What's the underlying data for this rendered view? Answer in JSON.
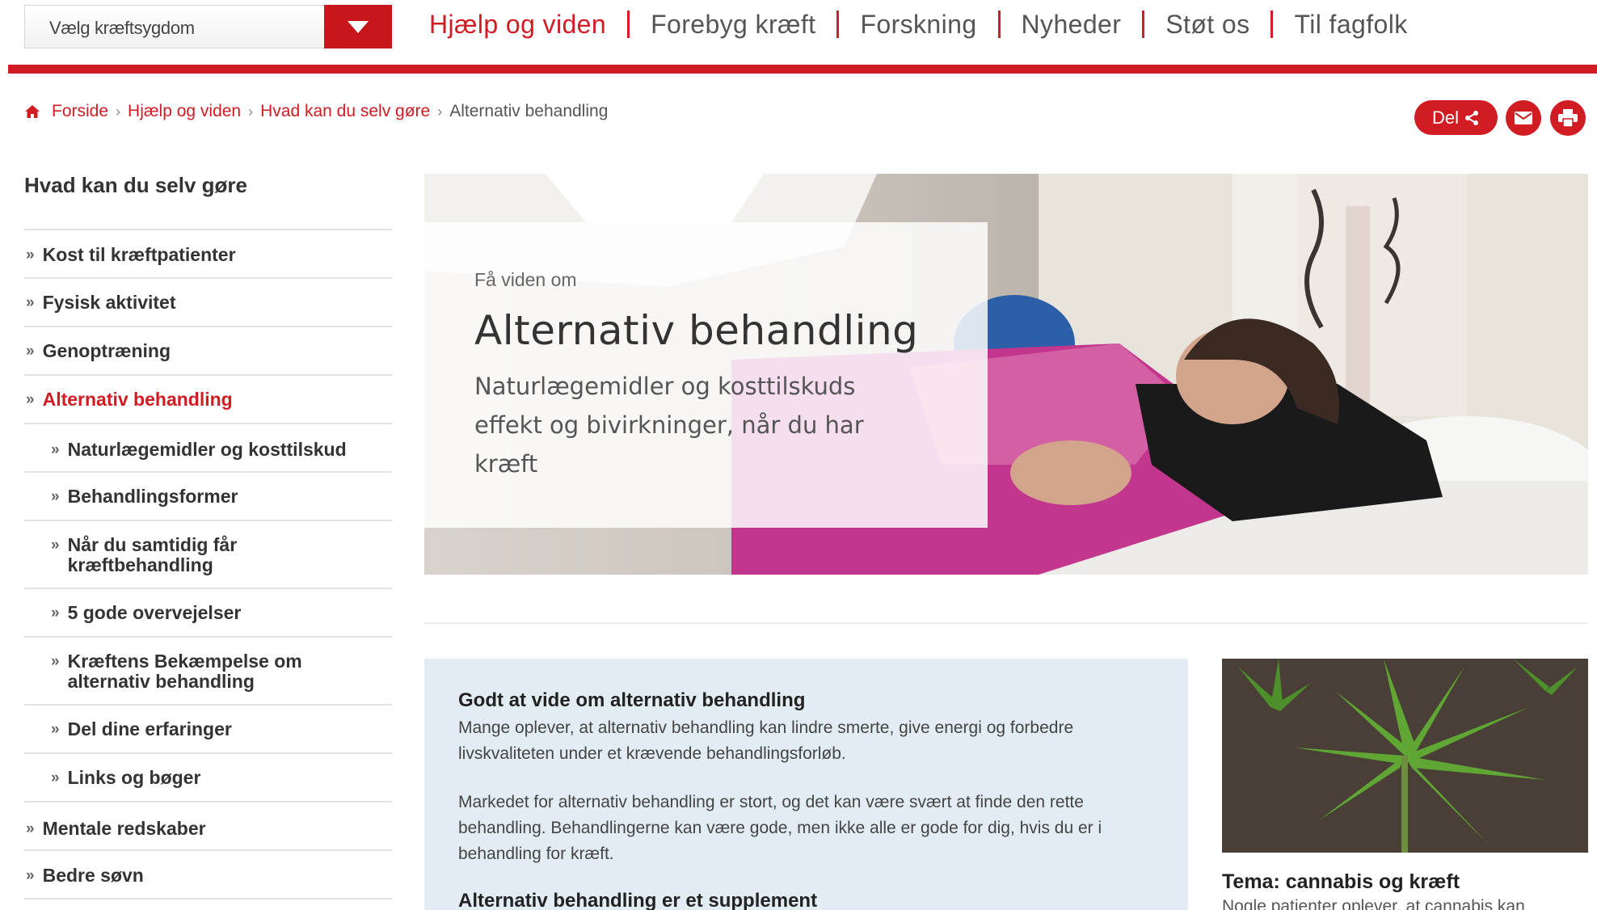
{
  "header": {
    "cancer_select": {
      "value": "Vælg kræftsygdom"
    },
    "nav": [
      {
        "label": "Hjælp og viden",
        "active": true
      },
      {
        "label": "Forebyg kræft"
      },
      {
        "label": "Forskning"
      },
      {
        "label": "Nyheder"
      },
      {
        "label": "Støt os"
      },
      {
        "label": "Til fagfolk"
      }
    ]
  },
  "breadcrumb": {
    "home": "Forside",
    "items": [
      "Hjælp og viden",
      "Hvad kan du selv gøre"
    ],
    "current": "Alternativ behandling"
  },
  "actions": {
    "share_label": "Del",
    "mail_icon": "mail-icon",
    "print_icon": "printer-icon"
  },
  "sidebar": {
    "title": "Hvad kan du selv gøre",
    "items": [
      {
        "label": "Kost til kræftpatienter",
        "level": 1
      },
      {
        "label": "Fysisk aktivitet",
        "level": 1
      },
      {
        "label": "Genoptræning",
        "level": 1
      },
      {
        "label": "Alternativ behandling",
        "level": 1,
        "active": true
      },
      {
        "label": "Naturlægemidler og kosttilskud",
        "level": 2
      },
      {
        "label": "Behandlingsformer",
        "level": 2
      },
      {
        "label": "Når du samtidig får kræftbehandling",
        "level": 2
      },
      {
        "label": "5 gode overvejelser",
        "level": 2
      },
      {
        "label": "Kræftens Bekæmpelse om alternativ behandling",
        "level": 2
      },
      {
        "label": "Del dine erfaringer",
        "level": 2
      },
      {
        "label": "Links og bøger",
        "level": 2
      },
      {
        "label": "Mentale redskaber",
        "level": 1
      },
      {
        "label": "Bedre søvn",
        "level": 1
      }
    ]
  },
  "hero": {
    "eyebrow": "Få viden om",
    "title": "Alternativ behandling",
    "subtitle": "Naturlægemidler og kosttilskuds effekt og bivirkninger, når du har kræft"
  },
  "info": {
    "heading1": "Godt at vide om alternativ behandling",
    "para1": "Mange oplever, at alternativ behandling kan lindre smerte, give energi og forbedre livskvaliteten under et krævende behandlingsforløb.",
    "para2": "Markedet for alternativ behandling er stort, og det kan være svært at finde den rette behandling. Behandlingerne kan være gode, men ikke alle er gode for dig, hvis du er i behandling for kræft.",
    "heading2": "Alternativ behandling er et supplement"
  },
  "sidecard": {
    "title": "Tema: cannabis og kræft",
    "text": "Nogle patienter oplever, at cannabis kan"
  },
  "colors": {
    "brand_red": "#d01c22",
    "info_bg": "#e2edf3",
    "text": "#333333"
  }
}
